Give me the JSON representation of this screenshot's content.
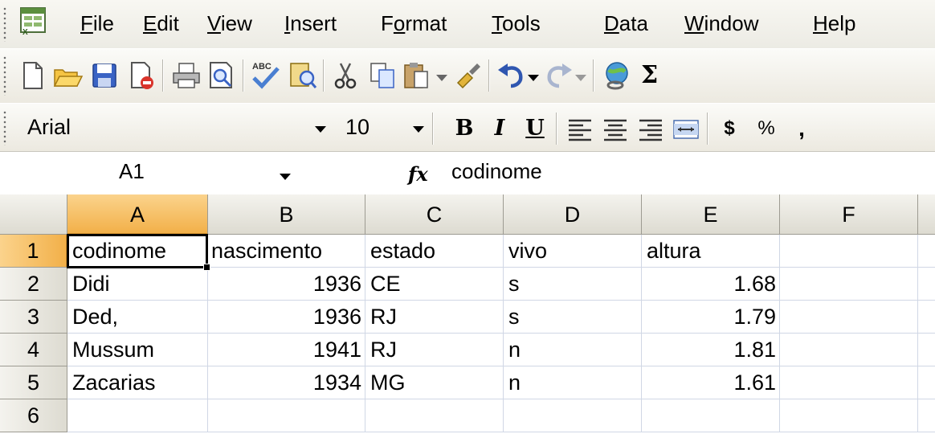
{
  "menu": [
    {
      "mnemonic": "F",
      "rest": "ile"
    },
    {
      "mnemonic": "E",
      "rest": "dit"
    },
    {
      "mnemonic": "V",
      "rest": "iew"
    },
    {
      "mnemonic": "I",
      "rest": "nsert"
    },
    {
      "pre": "F",
      "mnemonic": "o",
      "rest": "rmat"
    },
    {
      "mnemonic": "T",
      "rest": "ools"
    },
    {
      "mnemonic": "D",
      "rest": "ata"
    },
    {
      "mnemonic": "W",
      "rest": "indow"
    },
    {
      "mnemonic": "H",
      "rest": "elp"
    }
  ],
  "toolbar": {
    "standard_icons": [
      "new-icon",
      "open-icon",
      "save-icon",
      "permission-icon",
      "print-icon",
      "print-preview-icon",
      "spelling-icon",
      "research-icon",
      "cut-icon",
      "copy-icon",
      "paste-icon",
      "format-painter-icon",
      "undo-icon",
      "redo-icon",
      "hyperlink-icon",
      "autosum-icon"
    ],
    "autosum_glyph": "Σ"
  },
  "format_toolbar": {
    "font": "Arial",
    "size": "10",
    "bold_label": "B",
    "italic_label": "I",
    "underline_label": "U",
    "currency_label": "$",
    "percent_label": "%",
    "comma_label": ","
  },
  "formula_bar": {
    "name_box": "A1",
    "fx_label": "fx",
    "content": "codinome"
  },
  "sheet": {
    "columns": [
      "A",
      "B",
      "C",
      "D",
      "E",
      "F"
    ],
    "row_numbers": [
      "1",
      "2",
      "3",
      "4",
      "5",
      "6"
    ],
    "rows": [
      [
        "codinome",
        "nascimento",
        "estado",
        "vivo",
        "altura",
        ""
      ],
      [
        "Didi",
        "1936",
        "CE",
        "s",
        "1.68",
        ""
      ],
      [
        "Ded,",
        "1936",
        "RJ",
        "s",
        "1.79",
        ""
      ],
      [
        "Mussum",
        "1941",
        "RJ",
        "n",
        "1.81",
        ""
      ],
      [
        "Zacarias",
        "1934",
        "MG",
        "n",
        "1.61",
        ""
      ]
    ],
    "active_cell": "A1"
  },
  "colors": {
    "active_header": "#f2b049",
    "gridline": "#d0d7e5",
    "toolbar_bg": "#ece9e0"
  }
}
